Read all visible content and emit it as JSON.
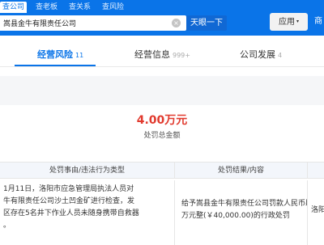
{
  "nav": {
    "tabs": [
      "查公司",
      "查老板",
      "查关系",
      "查风险"
    ]
  },
  "search": {
    "value": "嵩县金牛有限责任公司",
    "clear_icon": "×",
    "button_label": "天眼一下"
  },
  "header": {
    "app_label": "应用",
    "app_caret": "▾",
    "cut_text": "商"
  },
  "section_tabs": [
    {
      "label": "经营风险",
      "count": "11"
    },
    {
      "label": "经营信息",
      "count": "999+"
    },
    {
      "label": "公司发展",
      "count": "4"
    }
  ],
  "penalty": {
    "amount": "4.00万元",
    "amount_label": "处罚总金额"
  },
  "table": {
    "headers": [
      "处罚事由/违法行为类型",
      "处罚结果/内容"
    ],
    "row": {
      "reason_lines": [
        "1月11日，洛阳市应急管理局执法人员对",
        "牛有限责任公司沙土凹金矿进行检查，发",
        "区存在5名井下作业人员未随身携带自救器",
        "。"
      ],
      "result_lines": [
        "给予嵩县金牛有限责任公司罚款人民币肆",
        "万元整(￥40,000.00)的行政处罚"
      ],
      "authority": "洛阳"
    }
  },
  "colors": {
    "brand_blue": "#0a74e8",
    "amount_red": "#e13a2e"
  }
}
